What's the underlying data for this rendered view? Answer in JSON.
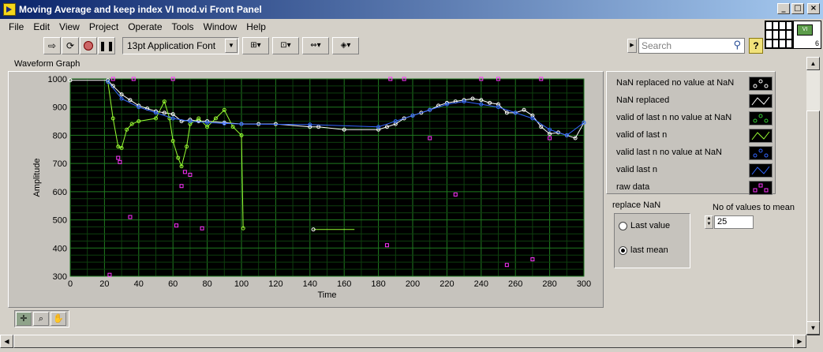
{
  "window": {
    "title": "Moving Average and keep index VI mod.vi Front Panel",
    "controls": [
      "_",
      "□",
      "×"
    ]
  },
  "menu": [
    "File",
    "Edit",
    "View",
    "Project",
    "Operate",
    "Tools",
    "Window",
    "Help"
  ],
  "toolbar": {
    "font": "13pt Application Font",
    "search_placeholder": "Search",
    "help_label": "?",
    "vi_icon_label": "VI",
    "vi_badge": "6"
  },
  "graph": {
    "label": "Waveform Graph",
    "xlabel": "Time",
    "ylabel": "Amplitude",
    "xticks": [
      "0",
      "20",
      "40",
      "60",
      "80",
      "100",
      "120",
      "140",
      "160",
      "180",
      "200",
      "220",
      "240",
      "260",
      "280",
      "300"
    ],
    "yticks": [
      "1000",
      "900",
      "800",
      "700",
      "600",
      "500",
      "400",
      "300"
    ]
  },
  "legend": [
    {
      "label": "NaN replaced no value at NaN",
      "style": "points",
      "color": "#ffffff"
    },
    {
      "label": "NaN replaced",
      "style": "line",
      "color": "#ffffff"
    },
    {
      "label": "valid of  last n no value at NaN",
      "style": "points",
      "color": "#33cc33"
    },
    {
      "label": "valid of last n",
      "style": "line",
      "color": "#99ff33"
    },
    {
      "label": "valid last n no value at NaN",
      "style": "points",
      "color": "#3366ff"
    },
    {
      "label": "valid last n",
      "style": "line",
      "color": "#3366ff"
    },
    {
      "label": "raw data",
      "style": "points",
      "color": "#ff33ff"
    }
  ],
  "replace_nan": {
    "label": "replace NaN",
    "options": [
      "Last value",
      "last mean"
    ],
    "selected": "last mean"
  },
  "n_mean": {
    "label": "No of values to mean",
    "value": "25"
  },
  "tools": [
    "cursor-icon",
    "zoom-icon",
    "pan-icon"
  ],
  "chart_data": {
    "type": "line",
    "xlabel": "Time",
    "ylabel": "Amplitude",
    "xlim": [
      0,
      300
    ],
    "ylim": [
      300,
      1000
    ],
    "grid": true,
    "series": [
      {
        "name": "NaN replaced",
        "color": "#ffffff",
        "x": [
          0,
          22,
          25,
          30,
          35,
          40,
          45,
          50,
          55,
          60,
          65,
          70,
          75,
          80,
          90,
          100,
          110,
          120,
          140,
          145,
          160,
          180,
          185,
          190,
          195,
          200,
          205,
          210,
          215,
          220,
          225,
          230,
          235,
          240,
          245,
          250,
          255,
          260,
          265,
          270,
          275,
          280,
          285,
          290,
          295,
          300
        ],
        "y": [
          995,
          995,
          975,
          945,
          925,
          905,
          895,
          885,
          880,
          875,
          850,
          855,
          850,
          850,
          845,
          840,
          840,
          840,
          830,
          830,
          820,
          820,
          830,
          840,
          860,
          870,
          880,
          890,
          905,
          915,
          920,
          925,
          930,
          925,
          915,
          910,
          880,
          880,
          890,
          870,
          830,
          805,
          810,
          800,
          790,
          845
        ]
      },
      {
        "name": "valid of last n",
        "color": "#99ff33",
        "x": [
          22,
          25,
          28,
          30,
          33,
          36,
          40,
          50,
          55,
          58,
          60,
          63,
          65,
          68,
          70,
          75,
          80,
          85,
          90,
          95,
          100,
          101
        ],
        "y": [
          990,
          860,
          760,
          755,
          820,
          840,
          850,
          860,
          920,
          860,
          780,
          720,
          690,
          760,
          840,
          860,
          830,
          860,
          890,
          830,
          800,
          470
        ]
      },
      {
        "name": "valid last n",
        "color": "#3366ff",
        "x": [
          22,
          30,
          40,
          50,
          60,
          70,
          80,
          90,
          100,
          140,
          180,
          190,
          200,
          210,
          220,
          230,
          240,
          250,
          260,
          270,
          280,
          290,
          300
        ],
        "y": [
          990,
          930,
          900,
          880,
          860,
          850,
          845,
          842,
          840,
          838,
          830,
          850,
          870,
          890,
          910,
          920,
          910,
          900,
          880,
          860,
          820,
          800,
          845
        ]
      },
      {
        "name": "raw data",
        "color": "#ff33ff",
        "x": [
          23,
          25,
          28,
          29,
          35,
          37,
          60,
          62,
          65,
          67,
          70,
          77,
          185,
          187,
          195,
          210,
          225,
          240,
          250,
          255,
          270,
          275,
          280
        ],
        "y": [
          305,
          1000,
          720,
          705,
          510,
          1000,
          1000,
          480,
          620,
          670,
          660,
          470,
          410,
          1000,
          1000,
          790,
          590,
          1000,
          1000,
          340,
          360,
          1000,
          790
        ]
      }
    ],
    "segments": [
      {
        "x": [
          142,
          166
        ],
        "y": [
          466,
          466
        ],
        "color": "#99ff33"
      }
    ]
  }
}
